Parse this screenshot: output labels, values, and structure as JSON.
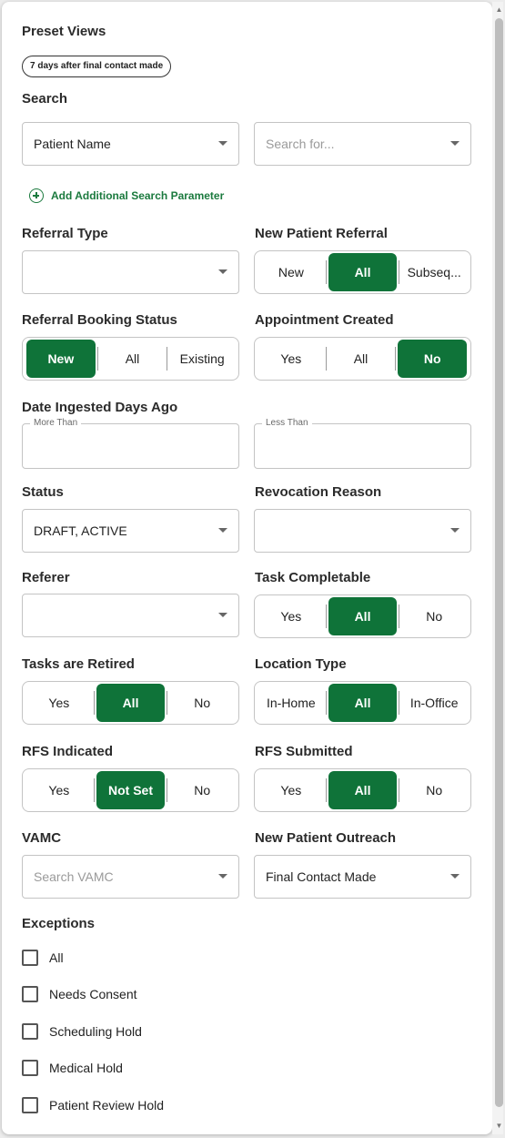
{
  "preset_views": {
    "title": "Preset Views",
    "chip": "7 days after final contact made"
  },
  "search": {
    "title": "Search",
    "field_value": "Patient Name",
    "search_placeholder": "Search for...",
    "add_parameter": "Add Additional Search Parameter"
  },
  "referral_type": {
    "title": "Referral Type",
    "value": ""
  },
  "new_patient_referral": {
    "title": "New Patient Referral",
    "options": [
      "New",
      "All",
      "Subseq..."
    ],
    "selected": "All"
  },
  "referral_booking_status": {
    "title": "Referral Booking Status",
    "options": [
      "New",
      "All",
      "Existing"
    ],
    "selected": "New"
  },
  "appointment_created": {
    "title": "Appointment Created",
    "options": [
      "Yes",
      "All",
      "No"
    ],
    "selected": "No"
  },
  "date_ingested": {
    "title": "Date Ingested Days Ago",
    "more_than": "More Than",
    "less_than": "Less Than"
  },
  "status": {
    "title": "Status",
    "value": "DRAFT, ACTIVE"
  },
  "revocation_reason": {
    "title": "Revocation Reason",
    "value": ""
  },
  "referer": {
    "title": "Referer",
    "value": ""
  },
  "task_completable": {
    "title": "Task Completable",
    "options": [
      "Yes",
      "All",
      "No"
    ],
    "selected": "All"
  },
  "tasks_retired": {
    "title": "Tasks are Retired",
    "options": [
      "Yes",
      "All",
      "No"
    ],
    "selected": "All"
  },
  "location_type": {
    "title": "Location Type",
    "options": [
      "In-Home",
      "All",
      "In-Office"
    ],
    "selected": "All"
  },
  "rfs_indicated": {
    "title": "RFS Indicated",
    "options": [
      "Yes",
      "Not Set",
      "No"
    ],
    "selected": "Not Set"
  },
  "rfs_submitted": {
    "title": "RFS Submitted",
    "options": [
      "Yes",
      "All",
      "No"
    ],
    "selected": "All"
  },
  "vamc": {
    "title": "VAMC",
    "placeholder": "Search VAMC"
  },
  "new_patient_outreach": {
    "title": "New Patient Outreach",
    "value": "Final Contact Made"
  },
  "exceptions": {
    "title": "Exceptions",
    "items": [
      "All",
      "Needs Consent",
      "Scheduling Hold",
      "Medical Hold",
      "Patient Review Hold"
    ]
  },
  "colors": {
    "accent": "#0f7339",
    "link": "#1b7a3e"
  }
}
